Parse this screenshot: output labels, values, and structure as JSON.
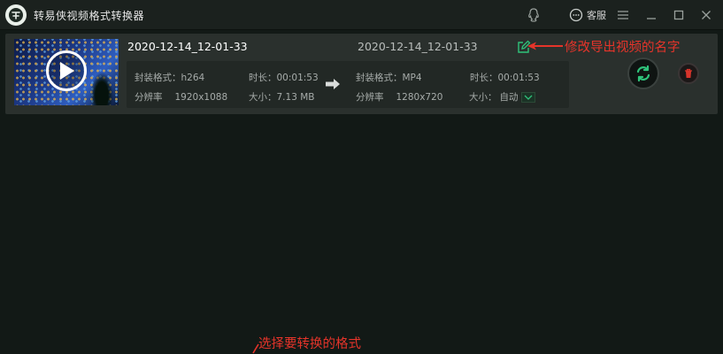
{
  "app": {
    "title": "转易侠视频格式转换器"
  },
  "titlebar": {
    "service_label": "客服",
    "icons": [
      "qq-icon",
      "chat-bubble-icon",
      "menu-icon",
      "minimize-icon",
      "maximize-icon",
      "close-icon"
    ]
  },
  "task": {
    "source_name": "2020-12-14_12-01-33",
    "output_name": "2020-12-14_12-01-33",
    "source": {
      "container_label": "封装格式：",
      "container": "h264",
      "duration_label": "时长：",
      "duration": "00:01:53",
      "resolution_label": "分辨率",
      "resolution": "1920x1088",
      "size_label": "大小：",
      "size": "7.13 MB"
    },
    "target": {
      "container_label": "封装格式：",
      "container": "MP4",
      "duration_label": "时长：",
      "duration": "00:01:53",
      "resolution_label": "分辨率",
      "resolution": "1280x720",
      "size_label": "大小：",
      "size": "自动"
    }
  },
  "annotations": {
    "rename_hint": "修改导出视频的名字",
    "format_hint": "选择要转换的格式"
  },
  "colors": {
    "accent_green": "#2fc27a",
    "annotation_red": "#e5342a",
    "delete_red": "#d9342b",
    "background": "#121916",
    "card": "#2a302d"
  }
}
